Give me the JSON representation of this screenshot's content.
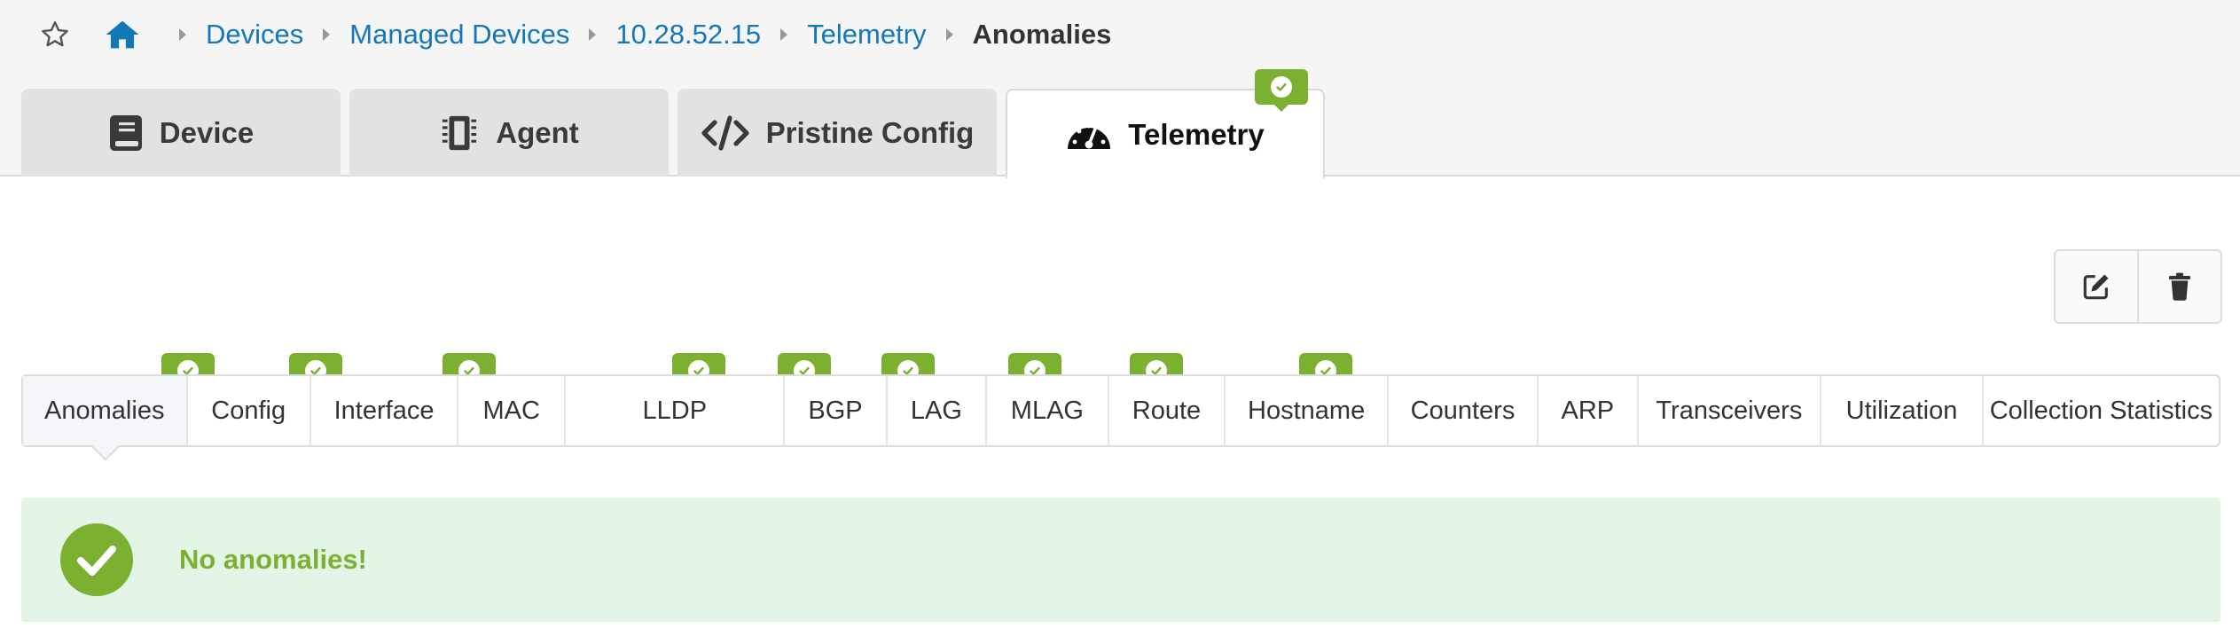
{
  "breadcrumb": {
    "items": [
      "Devices",
      "Managed Devices",
      "10.28.52.15",
      "Telemetry"
    ],
    "current": "Anomalies"
  },
  "tabs": [
    {
      "label": "Device",
      "icon": "book-icon"
    },
    {
      "label": "Agent",
      "icon": "chip-icon"
    },
    {
      "label": "Pristine Config",
      "icon": "code-icon"
    },
    {
      "label": "Telemetry",
      "icon": "dashboard-icon",
      "active": true,
      "status": "ok"
    }
  ],
  "subtabs": [
    {
      "label": "Anomalies",
      "active": true
    },
    {
      "label": "Config",
      "status": "ok"
    },
    {
      "label": "Interface",
      "status": "ok"
    },
    {
      "label": "MAC"
    },
    {
      "label": "LLDP",
      "status": "ok"
    },
    {
      "label": "BGP",
      "status": "ok"
    },
    {
      "label": "LAG",
      "status": "ok"
    },
    {
      "label": "MLAG",
      "status": "ok"
    },
    {
      "label": "Route",
      "status": "ok"
    },
    {
      "label": "Hostname",
      "status": "ok"
    },
    {
      "label": "Counters"
    },
    {
      "label": "ARP"
    },
    {
      "label": "Transceivers"
    },
    {
      "label": "Utilization"
    },
    {
      "label": "Collection Statistics"
    }
  ],
  "actions": {
    "edit": "edit-icon",
    "delete": "trash-icon"
  },
  "message": {
    "text": "No anomalies!",
    "icon": "check-circle-icon"
  },
  "colors": {
    "accent": "#1478b8",
    "success": "#7bb031",
    "success_bg": "#e2f5e7"
  }
}
